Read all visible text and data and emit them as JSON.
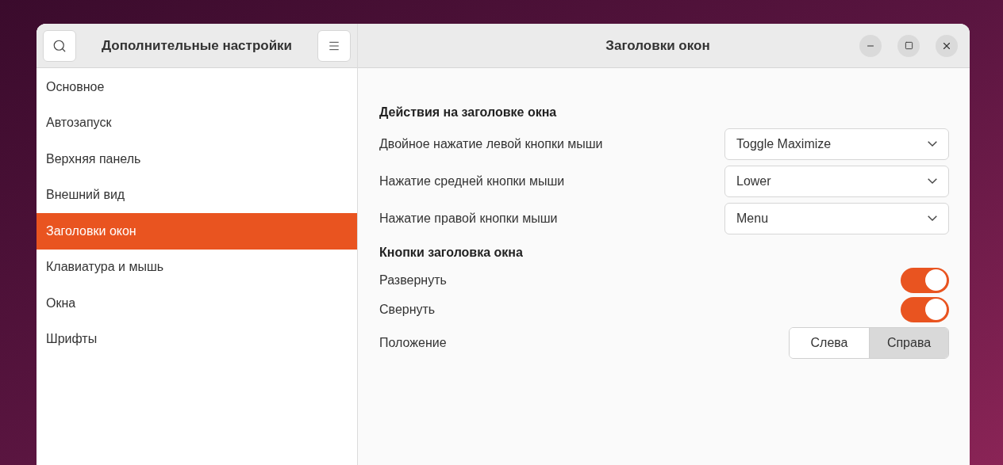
{
  "sidebar": {
    "title": "Дополнительные настройки",
    "items": [
      {
        "label": "Основное",
        "selected": false
      },
      {
        "label": "Автозапуск",
        "selected": false
      },
      {
        "label": "Верхняя панель",
        "selected": false
      },
      {
        "label": "Внешний вид",
        "selected": false
      },
      {
        "label": "Заголовки окон",
        "selected": true
      },
      {
        "label": "Клавиатура и мышь",
        "selected": false
      },
      {
        "label": "Окна",
        "selected": false
      },
      {
        "label": "Шрифты",
        "selected": false
      }
    ]
  },
  "window": {
    "title": "Заголовки окон"
  },
  "sections": [
    {
      "title": "Действия на заголовке окна",
      "rows": [
        {
          "kind": "dropdown",
          "label": "Двойное нажатие левой кнопки мыши",
          "value": "Toggle Maximize"
        },
        {
          "kind": "dropdown",
          "label": "Нажатие средней кнопки мыши",
          "value": "Lower"
        },
        {
          "kind": "dropdown",
          "label": "Нажатие правой кнопки мыши",
          "value": "Menu"
        }
      ]
    },
    {
      "title": "Кнопки заголовка окна",
      "rows": [
        {
          "kind": "switch",
          "label": "Развернуть",
          "on": true
        },
        {
          "kind": "switch",
          "label": "Свернуть",
          "on": true
        },
        {
          "kind": "segmented",
          "label": "Положение",
          "options": [
            {
              "label": "Слева",
              "selected": false
            },
            {
              "label": "Справа",
              "selected": true
            }
          ]
        }
      ]
    }
  ]
}
